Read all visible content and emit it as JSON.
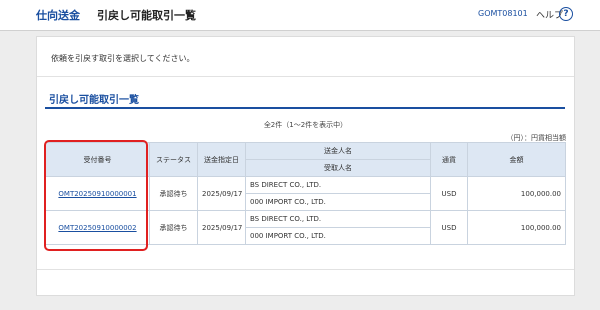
{
  "header": {
    "app_title": "仕向送金",
    "screen_title": "引戻し可能取引一覧",
    "screen_id": "GOMT08101",
    "help_label": "ヘルプ",
    "help_icon": "?"
  },
  "instruction": "依頼を引戻す取引を選択してください。",
  "section": {
    "title": "引戻し可能取引一覧",
    "count_text": "全2件（1～2件を表示中）",
    "unit_text": "（円）：円貨相当額"
  },
  "table": {
    "headers": {
      "receipt_no": "受付番号",
      "status": "ステータス",
      "date": "送金指定日",
      "remitter": "送金人名",
      "beneficiary": "受取人名",
      "currency": "通貨",
      "amount": "金額"
    },
    "rows": [
      {
        "receipt_no": "OMT20250910000001",
        "status": "承認待ち",
        "date": "2025/09/17",
        "remitter": "BS DIRECT CO., LTD.",
        "beneficiary": "000 IMPORT CO., LTD.",
        "currency": "USD",
        "amount": "100,000.00"
      },
      {
        "receipt_no": "OMT20250910000002",
        "status": "承認待ち",
        "date": "2025/09/17",
        "remitter": "BS DIRECT CO., LTD.",
        "beneficiary": "000 IMPORT CO., LTD.",
        "currency": "USD",
        "amount": "100,000.00"
      }
    ]
  },
  "colors": {
    "accent": "#1a4fa0",
    "header_bg": "#dde7f3",
    "highlight": "#e02020"
  }
}
